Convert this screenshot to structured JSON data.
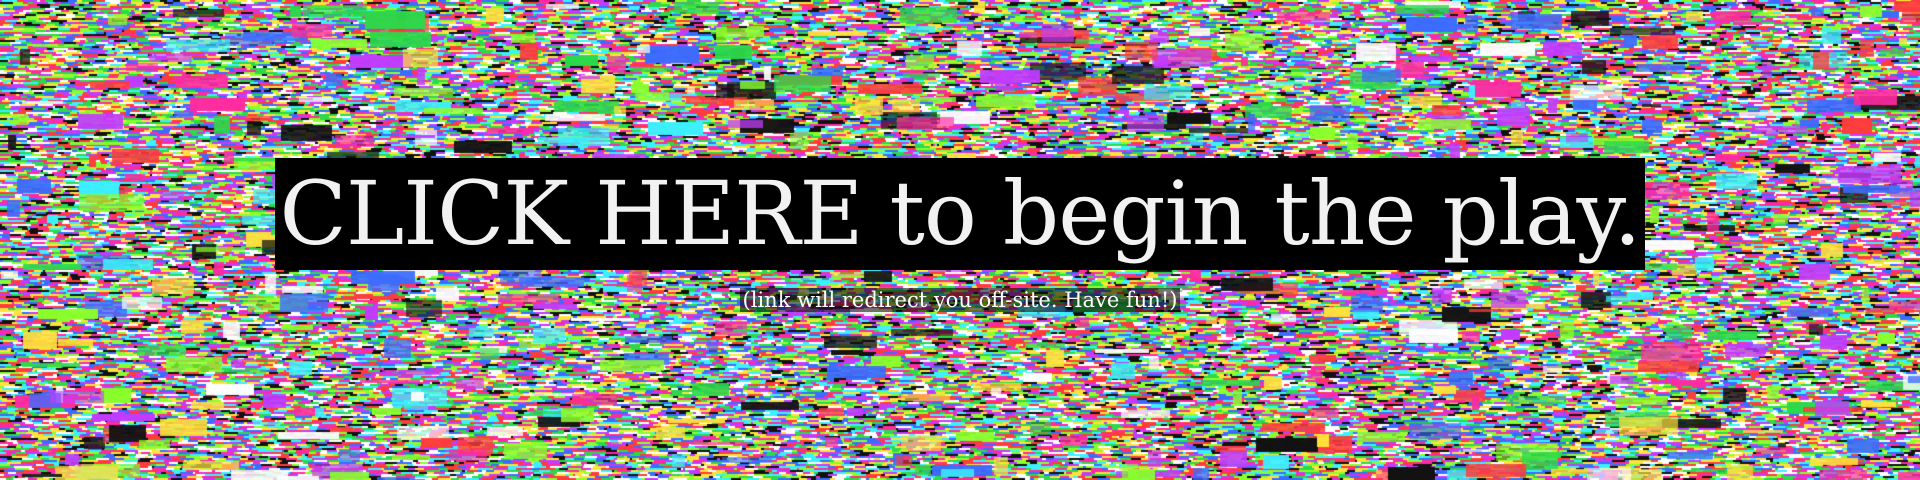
{
  "background": {
    "style": "glitch-noise",
    "palette": [
      "#ff2aa0",
      "#2bd94a",
      "#3b6cff",
      "#ffe23b",
      "#ffffff",
      "#111111",
      "#c23bff",
      "#ff3b3b",
      "#3bf0ff",
      "#8aff2b"
    ]
  },
  "cta": {
    "label": "CLICK HERE to begin the play.",
    "bg_color": "#000000",
    "text_color": "#f2f2f2"
  },
  "note": {
    "text": "(link will redirect you off-site. Have fun!)"
  }
}
